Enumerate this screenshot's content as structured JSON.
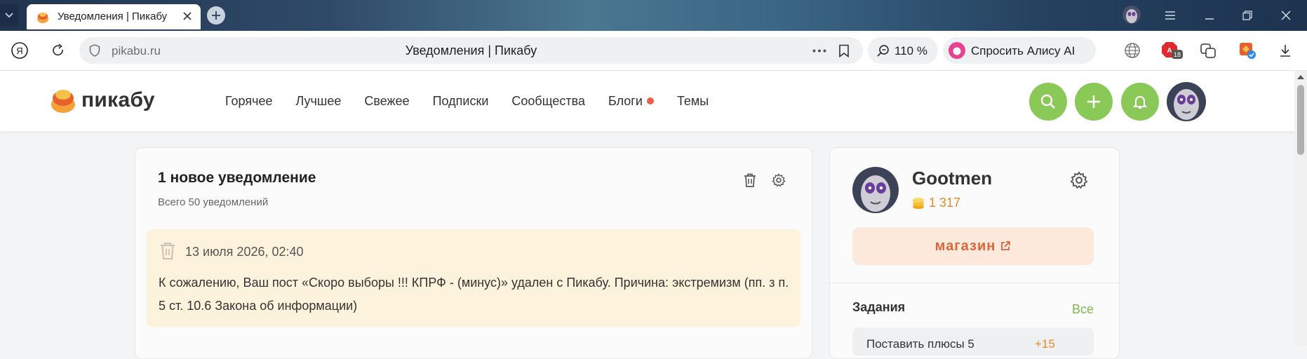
{
  "browser": {
    "tab_title": "Уведомления | Пикабу",
    "address_host": "pikabu.ru",
    "page_title": "Уведомления | Пикабу",
    "zoom": "110 %",
    "alice_label": "Спросить Алису AI",
    "extension_badge": "18"
  },
  "site": {
    "logo_text": "пикабу",
    "nav": [
      "Горячее",
      "Лучшее",
      "Свежее",
      "Подписки",
      "Сообщества",
      "Блоги",
      "Темы"
    ],
    "accent_color": "#8ac858"
  },
  "notifications": {
    "title": "1 новое уведомление",
    "subtitle": "Всего 50 уведомлений",
    "items": [
      {
        "date": "13 июля 2026, 02:40",
        "text": "К сожалению, Ваш пост «Скоро выборы !!! КПРФ - (минус)» удален с Пикабу. Причина: экстремизм (пп. з п. 5 ст. 10.6 Закона об информации)"
      }
    ]
  },
  "profile": {
    "name": "Gootmen",
    "coins": "1 317",
    "shop_label": "магазин",
    "tasks_title": "Задания",
    "tasks_all": "Все",
    "task_text": "Поставить плюсы 5",
    "task_reward": "+15"
  }
}
